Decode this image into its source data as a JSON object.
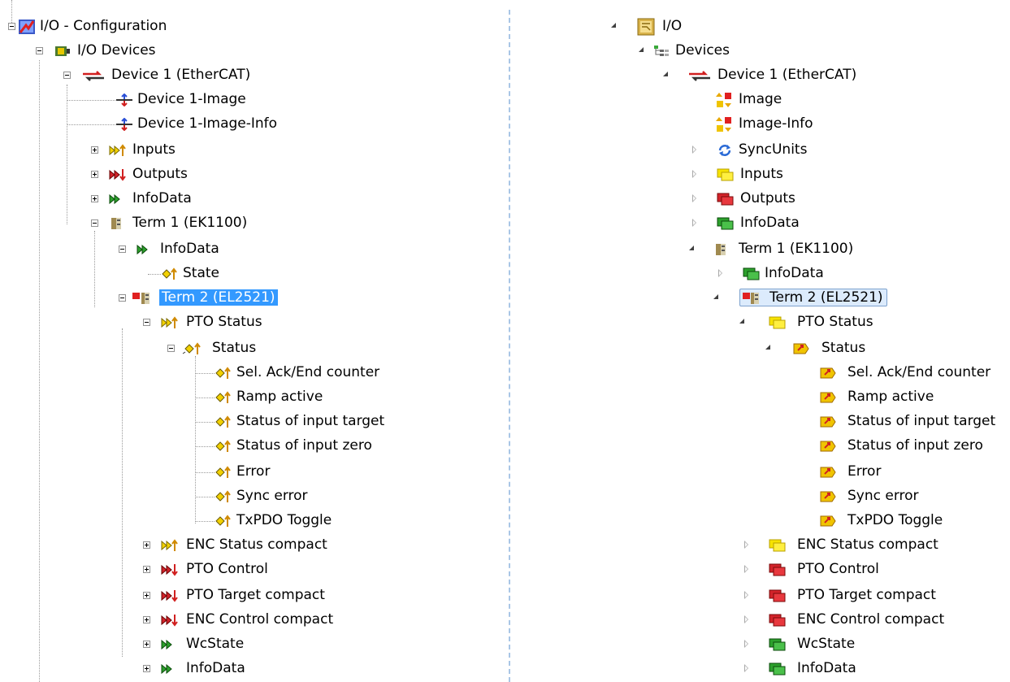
{
  "left_tree": {
    "root": "I/O - Configuration",
    "io_devices": "I/O Devices",
    "device": "Device 1 (EtherCAT)",
    "device_image": "Device 1-Image",
    "device_image_info": "Device 1-Image-Info",
    "inputs": "Inputs",
    "outputs": "Outputs",
    "infodata": "InfoData",
    "term1": "Term 1 (EK1100)",
    "term1_infodata": "InfoData",
    "state": "State",
    "term2": "Term 2 (EL2521)",
    "pto_status": "PTO Status",
    "status": "Status",
    "status_items": [
      "Sel. Ack/End counter",
      "Ramp active",
      "Status of input target",
      "Status of input zero",
      "Error",
      "Sync error",
      "TxPDO Toggle"
    ],
    "enc_status_compact": "ENC Status compact",
    "pto_control": "PTO Control",
    "pto_target_compact": "PTO Target compact",
    "enc_control_compact": "ENC Control compact",
    "wcstate": "WcState",
    "term2_infodata": "InfoData"
  },
  "right_tree": {
    "root": "I/O",
    "devices": "Devices",
    "device": "Device 1 (EtherCAT)",
    "image": "Image",
    "image_info": "Image-Info",
    "syncunits": "SyncUnits",
    "inputs": "Inputs",
    "outputs": "Outputs",
    "infodata": "InfoData",
    "term1": "Term 1 (EK1100)",
    "term1_infodata": "InfoData",
    "term2": "Term 2 (EL2521)",
    "pto_status": "PTO Status",
    "status": "Status",
    "status_items": [
      "Sel. Ack/End counter",
      "Ramp active",
      "Status of input target",
      "Status of input zero",
      "Error",
      "Sync error",
      "TxPDO Toggle"
    ],
    "enc_status_compact": "ENC Status compact",
    "pto_control": "PTO Control",
    "pto_target_compact": "PTO Target compact",
    "enc_control_compact": "ENC Control compact",
    "wcstate": "WcState",
    "term2_infodata": "InfoData"
  },
  "icon_colors": {
    "input": "#f2d100",
    "output": "#d2232a",
    "infodata": "#2ca02c",
    "selection": "#3399ff"
  }
}
